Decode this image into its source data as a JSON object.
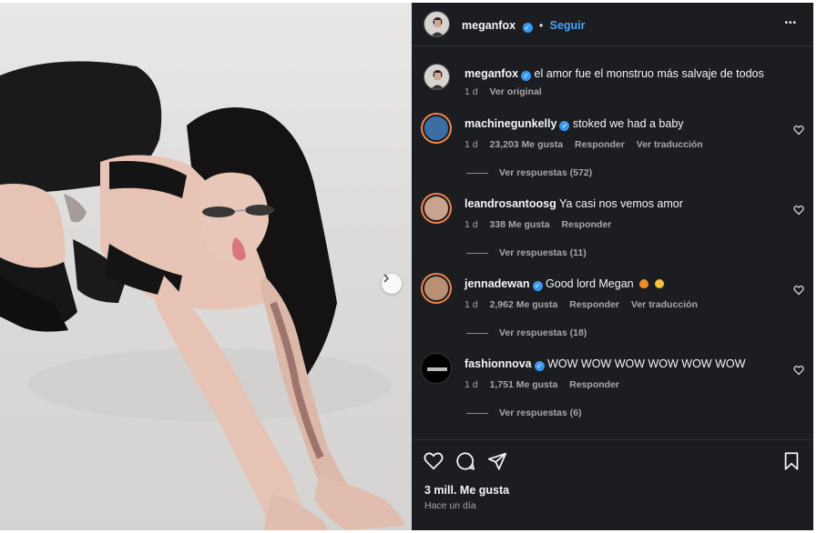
{
  "post": {
    "author": "meganfox",
    "follow_label": "Seguir",
    "dot": "•",
    "more_label": "•••"
  },
  "caption": {
    "user": "meganfox",
    "text": "el amor fue el monstruo más salvaje de todos",
    "time": "1 d",
    "original_label": "Ver original"
  },
  "comments": [
    {
      "user": "machinegunkelly",
      "verified": true,
      "text": "stoked we had a baby",
      "time": "1 d",
      "likes": "23,203 Me gusta",
      "reply": "Responder",
      "translate": "Ver traducción",
      "replies": "Ver respuestas (572)"
    },
    {
      "user": "leandrosantoosg",
      "verified": false,
      "text": "Ya casi nos vemos amor",
      "time": "1 d",
      "likes": "338 Me gusta",
      "reply": "Responder",
      "translate": "",
      "replies": "Ver respuestas (11)"
    },
    {
      "user": "jennadewan",
      "verified": true,
      "text": "Good lord Megan",
      "time": "1 d",
      "likes": "2,962 Me gusta",
      "reply": "Responder",
      "translate": "Ver traducción",
      "replies": "Ver respuestas (18)"
    },
    {
      "user": "fashionnova",
      "verified": true,
      "text": "WOW WOW WOW WOW WOW WOW",
      "time": "1 d",
      "likes": "1,751 Me gusta",
      "reply": "Responder",
      "translate": "",
      "replies": "Ver respuestas (6)"
    }
  ],
  "footer": {
    "likes": "3 mill. Me gusta",
    "time": "Hace un día"
  },
  "colors": {
    "panel_bg": "#1c1d21",
    "link_blue": "#4ba3f5",
    "verified_blue": "#3897f0",
    "muted_text": "#a8a8a8"
  },
  "icons": [
    "verified-icon",
    "more-icon",
    "heart-icon",
    "comment-icon",
    "share-icon",
    "bookmark-icon",
    "chevron-right-icon",
    "fire-emoji-icon",
    "heart-eyes-emoji-icon"
  ]
}
